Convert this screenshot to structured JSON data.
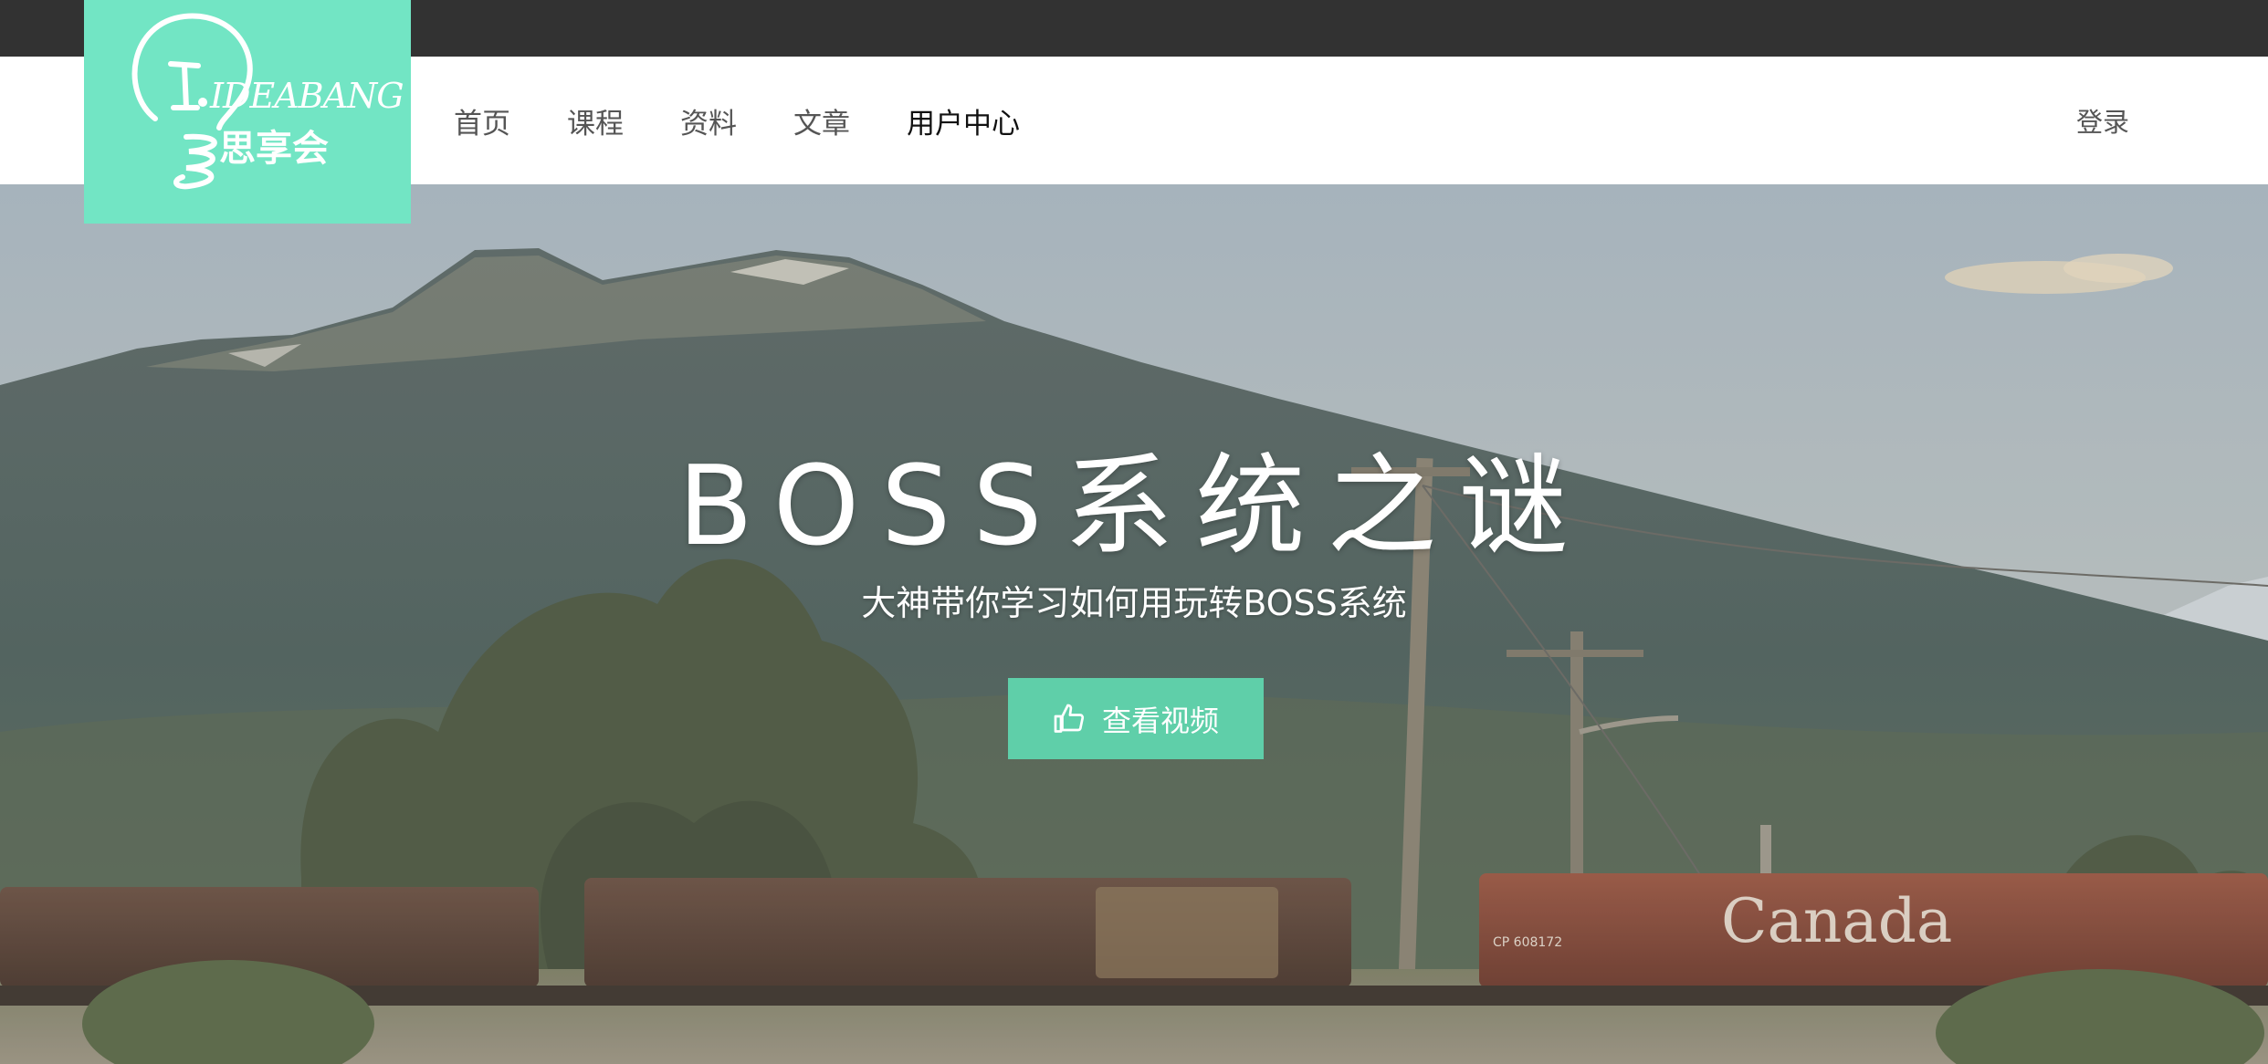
{
  "logo": {
    "text_en": "IDEABANG",
    "text_cn": "思享会",
    "background": "#72e5c4"
  },
  "nav": {
    "items": [
      {
        "label": "首页",
        "active": false
      },
      {
        "label": "课程",
        "active": false
      },
      {
        "label": "资料",
        "active": false
      },
      {
        "label": "文章",
        "active": false
      },
      {
        "label": "用户中心",
        "active": true
      }
    ],
    "login": "登录"
  },
  "hero": {
    "title": "BOSS系统之谜",
    "subtitle": "大神带你学习如何用玩转BOSS系统",
    "button_label": "查看视频",
    "button_icon": "thumbs-up-icon",
    "button_color": "#5fcfa9"
  },
  "colors": {
    "topbar": "#323232",
    "accent": "#72e5c4"
  }
}
